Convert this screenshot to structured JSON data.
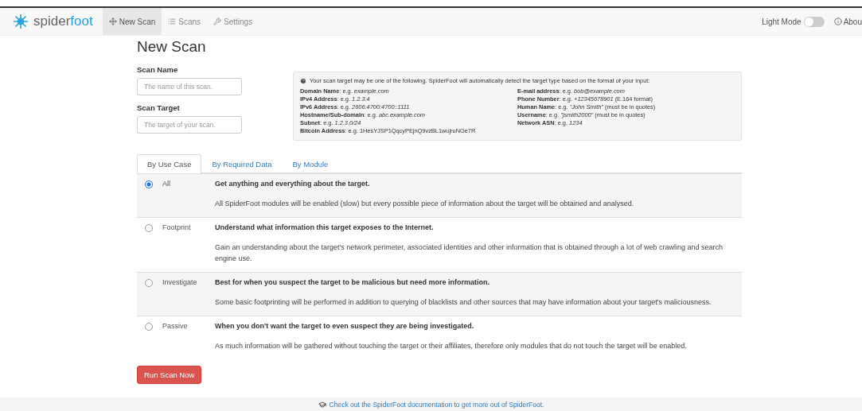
{
  "navbar": {
    "brand_first": "spider",
    "brand_second": "foot",
    "items": [
      {
        "label": "New Scan",
        "kind": "move",
        "selected": true
      },
      {
        "label": "Scans",
        "kind": "list",
        "selected": false
      },
      {
        "label": "Settings",
        "kind": "wrench",
        "selected": false
      }
    ],
    "light_mode": {
      "label": "Light Mode",
      "on": false
    },
    "about": "Abou"
  },
  "title": "New Scan",
  "form": {
    "scan_name": {
      "label": "Scan Name",
      "placeholder": "The name of this scan."
    },
    "scan_target": {
      "label": "Scan Target",
      "placeholder": "The target of your scan."
    }
  },
  "info": {
    "intro": "Your scan target may be one of the following. SpiderFoot will automatically detect the target type based on the format of your input:",
    "left": [
      "**Domain Name**: e.g. *example.com*",
      "**IPv4 Address**: e.g. *1.2.3.4*",
      "**IPv6 Address**: e.g. *2606:4700:4700::1111*",
      "**Hostname/Sub-domain**: e.g. *abc.example.com*",
      "**Subnet**: e.g. *1.2.3.0/24*",
      "**Bitcoin Address**: e.g. 1HesYJSP1QqcyPEjnQ9vzBL1wujruNGe7R"
    ],
    "right": [
      "**E-mail address**: e.g. *bob@example.com*",
      "**Phone Number**: e.g. *+12345678901* (E.164 format)",
      "**Human Name**: e.g. *\"John Smith\"* (must be in quotes)",
      "**Username**: e.g. *\"jsmith2000\"* (must be in quotes)",
      "**Network ASN**: e.g. *1234*"
    ]
  },
  "tabs": [
    {
      "label": "By Use Case",
      "selected": true
    },
    {
      "label": "By Required Data",
      "selected": false
    },
    {
      "label": "By Module",
      "selected": false
    }
  ],
  "use_cases": [
    {
      "label": "All",
      "selected": true,
      "title": "Get anything and everything about the target.",
      "description": "All SpiderFoot modules will be enabled (slow) but every possible piece of information about the target will be obtained and analysed."
    },
    {
      "label": "Footprint",
      "selected": false,
      "title": "Understand what information this target exposes to the Internet.",
      "description": "Gain an understanding about the target's network perimeter, associated identities and other information that is obtained through a lot of web crawling and search engine use."
    },
    {
      "label": "Investigate",
      "selected": false,
      "title": "Best for when you suspect the target to be malicious but need more information.",
      "description": "Some basic footprinting will be performed in addition to querying of blacklists and other sources that may have information about your target's maliciousness."
    },
    {
      "label": "Passive",
      "selected": false,
      "title": "When you don't want the target to even suspect they are being investigated.",
      "description": "As much information will be gathered without touching the target or their affiliates, therefore only modules that do not touch the target will be enabled."
    }
  ],
  "run_button": "Run Scan Now",
  "footer": "Check out the SpiderFoot documentation to get more out of SpiderFoot."
}
